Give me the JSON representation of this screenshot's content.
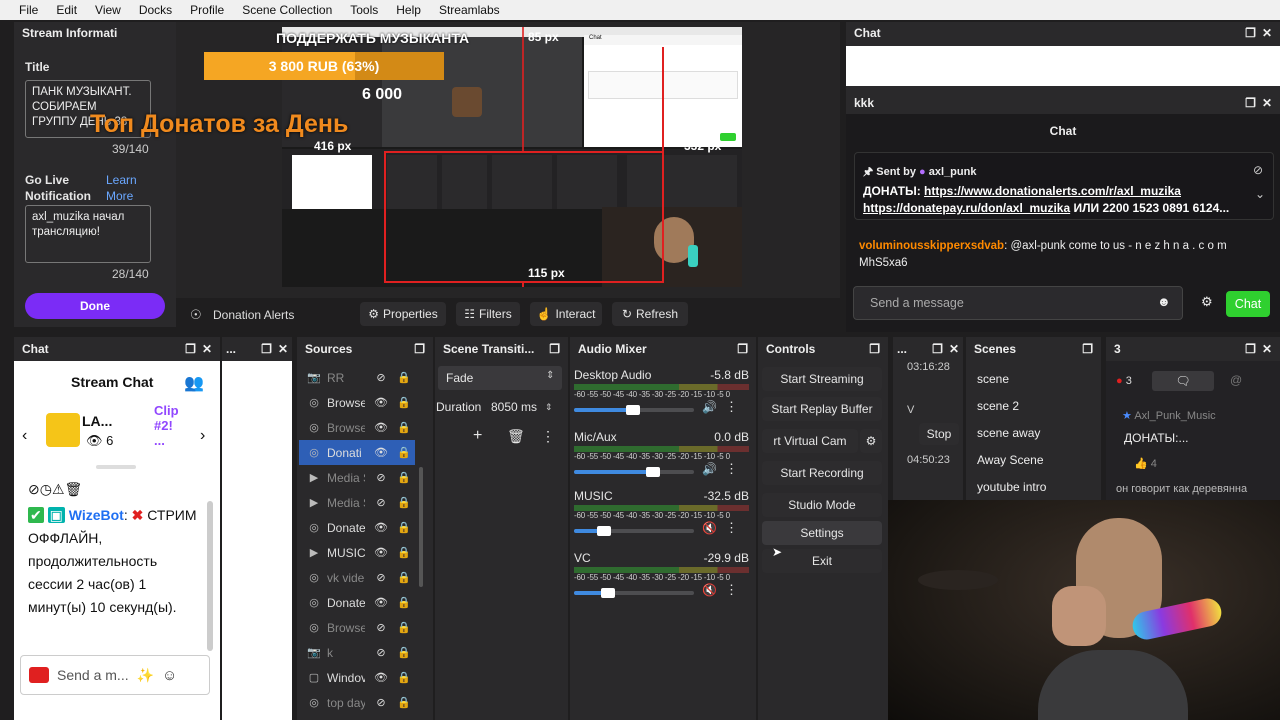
{
  "menu": [
    "File",
    "Edit",
    "View",
    "Docks",
    "Profile",
    "Scene Collection",
    "Tools",
    "Help",
    "Streamlabs"
  ],
  "stream_info": {
    "dock_title": "Stream Informati",
    "title_label": "Title",
    "title_value": "ПАНК МУЗЫКАНТ. СОБИРАЕМ ГРУППУ ДЕНЬ 33",
    "title_count": "39/140",
    "notification_label": "Go Live Notification",
    "learn_more": "Learn More",
    "notification_value": "axl_muzika начал трансляцию!",
    "notification_count": "28/140",
    "done_label": "Done"
  },
  "overlay": {
    "support_title": "ПОДДЕРЖАТЬ МУЗЫКАНТА",
    "goal_text": "3 800 RUB (63%)",
    "goal_progress": 0.63,
    "top_donations": "Топ Донатов за День",
    "top_amount": "6 000",
    "dim_top": "85 px",
    "dim_left": "416 px",
    "dim_right": "332 px",
    "dim_bottom": "115 px"
  },
  "preview_toolbar": {
    "source_name": "Donation Alerts",
    "properties": "Properties",
    "filters": "Filters",
    "interact": "Interact",
    "refresh": "Refresh"
  },
  "right_chat": {
    "dock_title": "Chat",
    "kkk_title": "kkk",
    "chat_header": "Chat",
    "sent_by_label": "Sent by",
    "sent_by_user": "axl_punk",
    "pinned_prefix": "ДОНАТЫ: ",
    "pinned_link1": "https://www.donationalerts.com/r/axl_muzika",
    "pinned_link2": "https://donatepay.ru/don/axl_muzika",
    "pinned_tail": " ИЛИ 2200 1523 0891 6124...",
    "msg_user": "voluminousskipperxsdvab",
    "msg_text": ": @axl-punk come to us - n e z h n a . c o m",
    "msg_line2": "MhS5xa6",
    "input_placeholder": "Send a message",
    "chat_button": "Chat"
  },
  "left_chat": {
    "dock_title": "Chat",
    "header": "Stream Chat",
    "ticker_name": "LA...",
    "ticker_count": "6",
    "clip_label": "Clip",
    "clip_num": "#2!",
    "clip_more": "...",
    "bot_name": "WizeBot",
    "bot_colon": ":",
    "bot_message": "СТРИМ ОФФЛАЙН, продолжительность сессии 2 час(ов) 1 минут(ы) 10 секунд(ы).",
    "input_placeholder": "Send a m..."
  },
  "misc_dock": {
    "title": "..."
  },
  "sources": {
    "dock_title": "Sources",
    "items": [
      {
        "name": "RR",
        "icon": "camera-icon",
        "visible": false,
        "dim": true
      },
      {
        "name": "Browse",
        "icon": "globe-icon",
        "visible": true,
        "dim": false
      },
      {
        "name": "Browse",
        "icon": "globe-icon",
        "visible": true,
        "dim": true
      },
      {
        "name": "Donati",
        "icon": "globe-icon",
        "visible": true,
        "dim": false,
        "selected": true
      },
      {
        "name": "Media S",
        "icon": "play-icon",
        "visible": false,
        "dim": true
      },
      {
        "name": "Media S",
        "icon": "play-icon",
        "visible": false,
        "dim": true
      },
      {
        "name": "Donate",
        "icon": "globe-icon",
        "visible": true,
        "dim": false
      },
      {
        "name": "MUSIC",
        "icon": "play-icon",
        "visible": true,
        "dim": false
      },
      {
        "name": "vk vide",
        "icon": "globe-icon",
        "visible": false,
        "dim": true
      },
      {
        "name": "Donate",
        "icon": "globe-icon",
        "visible": true,
        "dim": false
      },
      {
        "name": "Browse",
        "icon": "globe-icon",
        "visible": false,
        "dim": true
      },
      {
        "name": "k",
        "icon": "camera-icon",
        "visible": false,
        "dim": true
      },
      {
        "name": "Windov",
        "icon": "window-icon",
        "visible": true,
        "dim": false
      },
      {
        "name": "top day",
        "icon": "globe-icon",
        "visible": false,
        "dim": true
      }
    ]
  },
  "transitions": {
    "dock_title": "Scene Transiti...",
    "type": "Fade",
    "duration_label": "Duration",
    "duration_value": "8050 ms"
  },
  "mixer": {
    "dock_title": "Audio Mixer",
    "scale": "-60 -55 -50 -45 -40 -35 -30 -25 -20 -15 -10 -5 0",
    "channels": [
      {
        "name": "Desktop Audio",
        "db": "-5.8 dB",
        "level": 0.49,
        "muted": false
      },
      {
        "name": "Mic/Aux",
        "db": "0.0 dB",
        "level": 0.66,
        "muted": false
      },
      {
        "name": "MUSIC",
        "db": "-32.5 dB",
        "level": 0.25,
        "muted": true
      },
      {
        "name": "VC",
        "db": "-29.9 dB",
        "level": 0.28,
        "muted": true
      }
    ]
  },
  "controls": {
    "dock_title": "Controls",
    "start_streaming": "Start Streaming",
    "start_replay": "Start Replay Buffer",
    "virtual_cam": "rt Virtual Cam",
    "start_recording": "Start Recording",
    "studio_mode": "Studio Mode",
    "settings": "Settings",
    "exit": "Exit"
  },
  "stats_dock": {
    "title": "...",
    "time1": "03:16:28",
    "v_label": "V",
    "stop": "Stop",
    "time2": "04:50:23"
  },
  "scenes": {
    "dock_title": "Scenes",
    "items": [
      "scene",
      "scene 2",
      "scene away",
      "Away Scene",
      "youtube intro"
    ]
  },
  "dock3": {
    "title": "3",
    "badge": "3",
    "user": "Axl_Punk_Music",
    "message": "ДОНАТЫ:...",
    "likes": "4",
    "behind_text": "он говорит как деревянна"
  },
  "colors": {
    "accent": "#7b2cf6",
    "select": "#2e5fb6",
    "chat_green": "#2fd02f",
    "goal": "#f5a623"
  }
}
